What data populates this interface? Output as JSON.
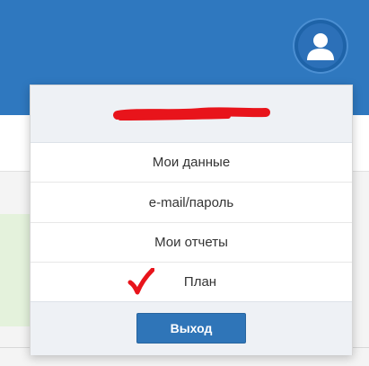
{
  "colors": {
    "header": "#2f78bf",
    "redaction": "#e8141b",
    "checkmark": "#e8141b",
    "button": "#2f75b8"
  },
  "user_icon": "user-avatar-icon",
  "menu": {
    "items": [
      {
        "label": "Мои данные"
      },
      {
        "label": "e-mail/пароль"
      },
      {
        "label": "Мои отчеты"
      },
      {
        "label": "План",
        "icon": "checkmark-icon"
      }
    ],
    "logout_label": "Выход"
  }
}
